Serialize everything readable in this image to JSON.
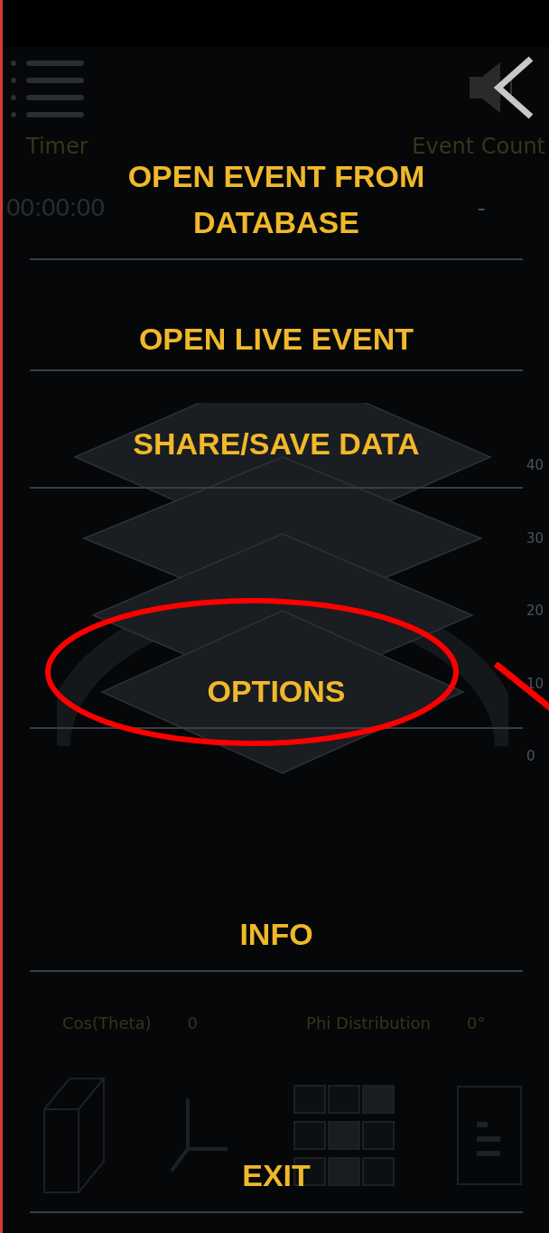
{
  "header": {
    "labels": [
      "Timer",
      "Event Count"
    ],
    "values": [
      "00:00:00",
      "-"
    ]
  },
  "chart": {
    "axis_ticks": [
      "40",
      "30",
      "20",
      "10",
      "0"
    ]
  },
  "stats": [
    {
      "label": "Cos(Theta)",
      "value": "0"
    },
    {
      "label": "Phi Distribution",
      "value": "0°"
    }
  ],
  "menu": {
    "items": [
      {
        "label": "OPEN EVENT FROM DATABASE",
        "highlighted": false
      },
      {
        "label": "OPEN LIVE EVENT",
        "highlighted": false
      },
      {
        "label": "SHARE/SAVE DATA",
        "highlighted": false
      },
      {
        "label": "OPTIONS",
        "highlighted": true
      },
      {
        "label": "INFO",
        "highlighted": false
      },
      {
        "label": "EXIT",
        "highlighted": false
      }
    ]
  }
}
